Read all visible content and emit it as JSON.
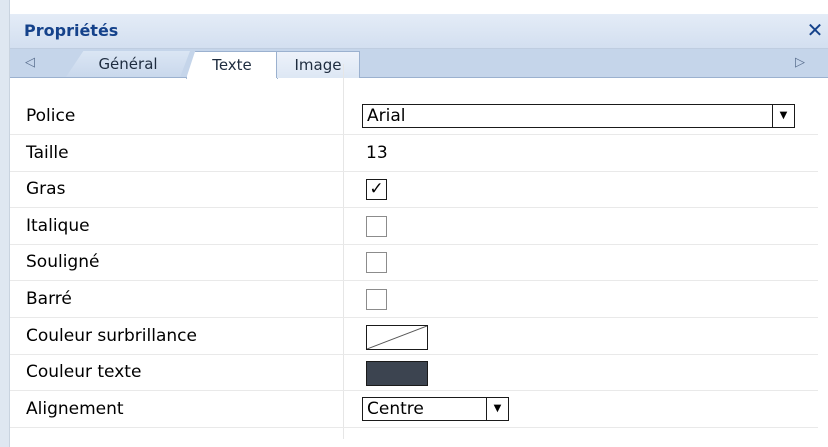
{
  "window": {
    "title": "Propriétés",
    "close_glyph": "✕"
  },
  "tabs": {
    "scroll_left_glyph": "◁",
    "scroll_right_glyph": "▷",
    "items": [
      {
        "label": "Général",
        "selected": false
      },
      {
        "label": "Texte",
        "selected": true
      },
      {
        "label": "Image",
        "selected": false
      }
    ]
  },
  "properties": [
    {
      "name": "Police",
      "type": "dropdown",
      "value": "Arial"
    },
    {
      "name": "Taille",
      "type": "text",
      "value": "13"
    },
    {
      "name": "Gras",
      "type": "checkbox",
      "checked": true
    },
    {
      "name": "Italique",
      "type": "checkbox",
      "checked": false
    },
    {
      "name": "Souligné",
      "type": "checkbox",
      "checked": false
    },
    {
      "name": "Barré",
      "type": "checkbox",
      "checked": false
    },
    {
      "name": "Couleur surbrillance",
      "type": "color",
      "value": "none"
    },
    {
      "name": "Couleur texte",
      "type": "color",
      "value": "#3c4450"
    },
    {
      "name": "Alignement",
      "type": "dropdown",
      "value": "Centre"
    }
  ],
  "glyphs": {
    "dropdown_arrow": "▼",
    "check": "✓"
  },
  "colors": {
    "title_text": "#15428b",
    "text_color_swatch": "#3c4450"
  }
}
